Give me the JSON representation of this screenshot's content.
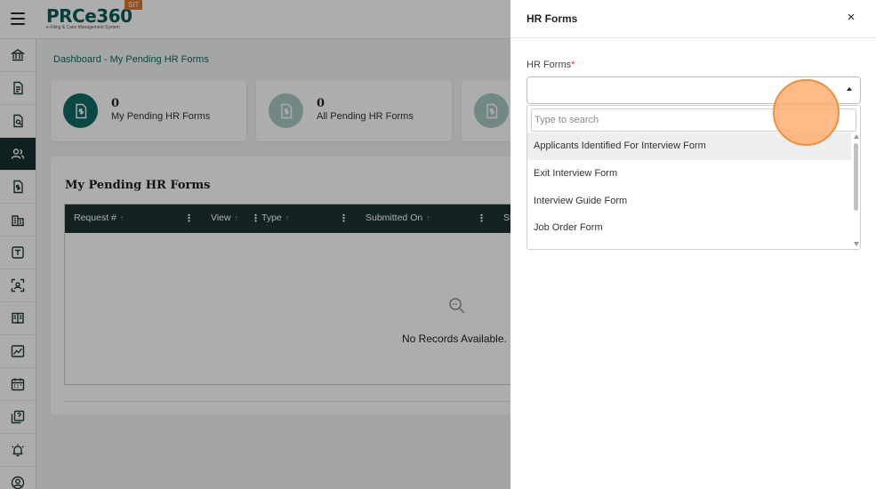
{
  "header": {
    "logo_main": "PRCe360",
    "logo_sub": "e-Filing & Case Management System",
    "env_badge": "SIT"
  },
  "sidebar": {
    "items": [
      {
        "icon": "bank-icon",
        "active": false
      },
      {
        "icon": "document-icon",
        "active": false
      },
      {
        "icon": "document-search-icon",
        "active": false
      },
      {
        "icon": "users-icon",
        "active": true
      },
      {
        "icon": "money-document-icon",
        "active": false
      },
      {
        "icon": "building-icon",
        "active": false
      },
      {
        "icon": "text-box-icon",
        "active": false
      },
      {
        "icon": "scan-icon",
        "active": false
      },
      {
        "icon": "book-icon",
        "active": false
      },
      {
        "icon": "chart-icon",
        "active": false
      },
      {
        "icon": "calendar-icon",
        "active": false
      },
      {
        "icon": "help-documents-icon",
        "active": false
      },
      {
        "icon": "alarm-icon",
        "active": false
      },
      {
        "icon": "profile-icon",
        "active": false
      }
    ]
  },
  "breadcrumb": "Dashboard - My Pending HR Forms",
  "cards": [
    {
      "count": "0",
      "label": "My Pending HR Forms",
      "color": "#0e6b65"
    },
    {
      "count": "0",
      "label": "All Pending HR Forms",
      "color": "#a8c9c4"
    },
    {
      "count": "",
      "label": "",
      "color": "#a8c9c4"
    }
  ],
  "panel": {
    "title": "My Pending HR Forms",
    "columns": [
      "Request #",
      "View",
      "Type",
      "Submitted On",
      "St"
    ],
    "empty_text": "No Records Available."
  },
  "drawer": {
    "title": "HR Forms",
    "close_glyph": "×",
    "field_label": "HR Forms",
    "required_mark": "*",
    "search_placeholder": "Type to search",
    "options": [
      "Applicants Identified For Interview Form",
      "Exit Interview Form",
      "Interview Guide Form",
      "Job Order Form"
    ]
  }
}
